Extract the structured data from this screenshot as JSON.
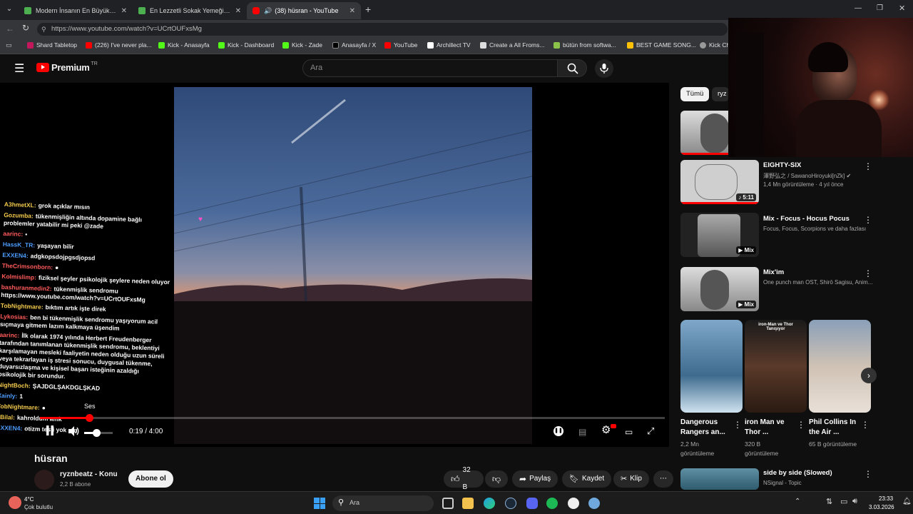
{
  "tabs": [
    {
      "title": "Modern İnsanın En Büyük Problem",
      "color": "#4caf50"
    },
    {
      "title": "En Lezzetli Sokak Yemeği [VİDEOL",
      "color": "#4caf50"
    },
    {
      "title": "(38) hüsran - YouTube",
      "color": "#ff0000"
    }
  ],
  "url": "https://www.youtube.com/watch?v=UCrtOUFxsMg",
  "bookmarks": [
    "Shard Tabletop",
    "(226) I've never pla...",
    "Kick - Anasayfa",
    "Kick - Dashboard",
    "Kick - Zade",
    "Anasayfa / X",
    "YouTube",
    "Archillect TV",
    "Create a All Froms...",
    "bütün from softwa...",
    "BEST GAME SONG...",
    "Kick Ch"
  ],
  "header": {
    "logo": "Premium",
    "logo_region": "TR",
    "search_placeholder": "Ara"
  },
  "chat": [
    {
      "user": "A3hmetXL:",
      "msg": "grok açıklar mısın",
      "color": "#f2c94c"
    },
    {
      "user": "Gozumba:",
      "msg": "tükenmişliğin altında dopamine bağlı problemler yatabilir mi peki @zade",
      "color": "#f2c94c"
    },
    {
      "user": "aarinc:",
      "msg": "▪",
      "color": "#ff5a5a"
    },
    {
      "user": "HassK_TR:",
      "msg": "yaşayan bilir",
      "color": "#4d9dff"
    },
    {
      "user": "EXXEN4:",
      "msg": "adgkopsdojpgsdjopsd",
      "color": "#4d9dff"
    },
    {
      "user": "TheCrimsonborn:",
      "msg": "●",
      "color": "#ff5a5a"
    },
    {
      "user": "Kolmislimp:",
      "msg": "fiziksel şeyler psikolojik şeylere neden oluyor",
      "color": "#ff5a5a"
    },
    {
      "user": "bashuranmedin2:",
      "msg": "tükenmişlik sendromu https://www.youtube.com/watch?v=UCrtOUFxsMg",
      "color": "#ff5a5a"
    },
    {
      "user": "TobNightmare:",
      "msg": "bıktım artık işte direk",
      "color": "#f2c94c"
    },
    {
      "user": "Lykosias:",
      "msg": "ben bi tükenmişlik sendromu yaşıyorum acil sıçmaya gitmem lazım kalkmaya üşendim",
      "color": "#ff5a5a"
    },
    {
      "user": "aarinc:",
      "msg": "İlk olarak 1974 yılında Herbert Freudenberger tarafından tanımlanan tükenmişlik sendromu, beklentiyi karşılamayan mesleki faaliyetin neden olduğu uzun süreli veya tekrarlayan iş stresi sonucu, duygusal tükenme, duyarsızlaşma ve kişisel başarı isteğinin azaldığı psikolojik bir sorundur.",
      "color": "#ff5a5a"
    },
    {
      "user": "NightBoch:",
      "msg": "ŞAJDGLŞAKDGLŞKAD",
      "color": "#f2c94c"
    },
    {
      "user": "Xainly:",
      "msg": "1",
      "color": "#4d9dff"
    },
    {
      "user": "TobNightmare:",
      "msg": "●",
      "color": "#f2c94c"
    },
    {
      "user": "0Bilal:",
      "msg": "kahroldum amk",
      "color": "#f2c94c"
    },
    {
      "user": "EXXEN4:",
      "msg": "otizm testi yok mu",
      "color": "#4d9dff"
    }
  ],
  "player": {
    "tooltip": "Ses",
    "time": "0:19 / 4:00",
    "progress_fraction": 0.079,
    "volume_fraction": 0.42
  },
  "video": {
    "title": "hüsran",
    "channel": "ryznbeatz - Konu",
    "subs": "2,2 B abone",
    "subscribe": "Abone ol",
    "likes": "32 B",
    "share": "Paylaş",
    "save": "Kaydet",
    "clip": "Klip"
  },
  "sidebar": {
    "chips": [
      "Tümü",
      "ryz"
    ],
    "items": [
      {
        "title": "EIGHTY-SIX",
        "meta1": "澤野弘之 / SawanoHiroyuki[nZk] ✔",
        "meta2": "1,4 Mn görüntüleme · 4 yıl önce",
        "badge": "♪ 5:11"
      },
      {
        "title": "Mix - Focus - Hocus Pocus",
        "meta1": "Focus, Focus, Scorpions ve daha fazlası",
        "meta2": "",
        "badge": "▶ Mix"
      },
      {
        "title": "Mix'im",
        "meta1": "One punch man OST, Shirō Sagisu, Anim...",
        "meta2": "",
        "badge": "▶ Mix"
      }
    ],
    "shorts": [
      {
        "title": "Dangerous Rangers an...",
        "views": "2,2 Mn görüntüleme"
      },
      {
        "title": "iron Man ve Thor ...",
        "views": "320 B görüntüleme",
        "overlay": "iron-Man ve Thor Tanışıyor"
      },
      {
        "title": "Phil Collins In the Air ...",
        "views": "65 B görüntüleme"
      }
    ],
    "last_item": {
      "title": "side by side (Slowed)",
      "meta": "NSignal - Topic"
    }
  },
  "taskbar": {
    "weather_temp": "4°C",
    "weather_text": "Çok bulutlu",
    "search": "Ara",
    "time": "23:33",
    "date": "3.03.2026"
  }
}
